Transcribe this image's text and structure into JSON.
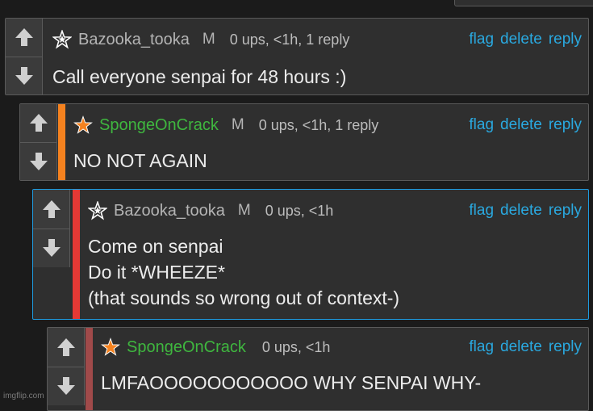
{
  "colors": {
    "background": "#1b1b1b",
    "panel": "#2f2f2f",
    "link": "#2aa9e0",
    "orange": "#f5821f",
    "red": "#e53935",
    "green": "#3fb73f",
    "blue_border": "#1e9be0"
  },
  "icons": {
    "upvote": "arrow-up-icon",
    "downvote": "arrow-down-icon",
    "rank": "star-icon"
  },
  "comments": [
    {
      "username": "Bazooka_tooka",
      "badge": "M",
      "meta": "0 ups, <1h, 1 reply",
      "text": "Call everyone senpai for 48 hours :)",
      "actions": {
        "flag": "flag",
        "delete": "delete",
        "reply": "reply"
      }
    },
    {
      "username": "SpongeOnCrack",
      "badge": "M",
      "meta": "0 ups, <1h, 1 reply",
      "text": "NO NOT AGAIN",
      "actions": {
        "flag": "flag",
        "delete": "delete",
        "reply": "reply"
      }
    },
    {
      "username": "Bazooka_tooka",
      "badge": "M",
      "meta": "0 ups, <1h",
      "text": "Come on senpai\nDo it *WHEEZE*\n(that sounds so wrong out of context-)",
      "actions": {
        "flag": "flag",
        "delete": "delete",
        "reply": "reply"
      }
    },
    {
      "username": "SpongeOnCrack",
      "badge": "",
      "meta": "0 ups, <1h",
      "text": "LMFAOOOOOOOOOOO WHY SENPAI WHY-",
      "actions": {
        "flag": "flag",
        "delete": "delete",
        "reply": "reply"
      }
    }
  ],
  "watermark": "imgflip.com"
}
